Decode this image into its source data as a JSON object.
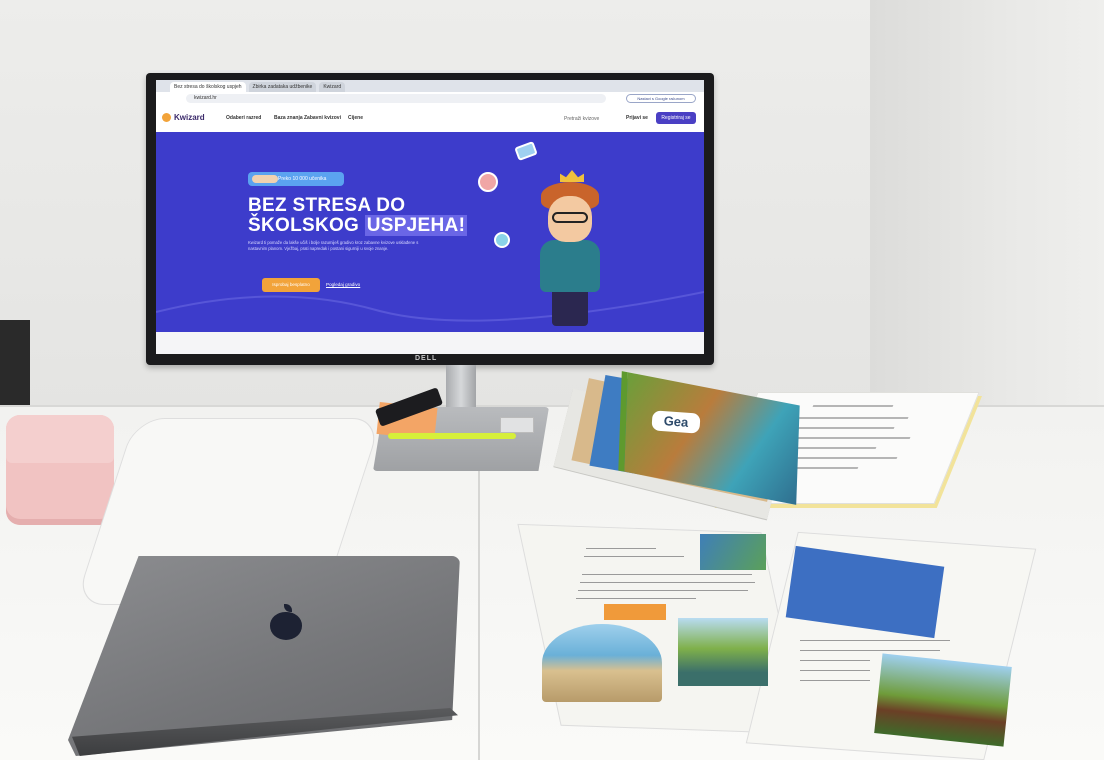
{
  "browser": {
    "tabs": [
      {
        "label": "Bez stresa do školskog uspjeh"
      },
      {
        "label": "Zbirka zadataka udžbenike"
      },
      {
        "label": "Kwizard"
      }
    ],
    "url": "kwizard.hr",
    "profile_button": "Nastavi s Google računom"
  },
  "site": {
    "logo": "Kwizard",
    "nav": [
      "Odaberi razred",
      "Baza znanja",
      "Zabavni kvizovi",
      "Cijene"
    ],
    "search_placeholder": "Pretraži kvizove",
    "login": "Prijavi se",
    "register": "Registriraj se",
    "hero": {
      "badge": "Preko 10 000 učenika",
      "title_line1": "BEZ STRESA DO",
      "title_line2a": "ŠKOLSKOG ",
      "title_line2b": "USPJEHA!",
      "text": "Kwizard ti pomaže da lakše učiš i bolje razumiješ gradivo kroz zabavne kvizove usklađene s nastavnim planom. Vježbaj, prati napredak i postani sigurniji u svoje znanje.",
      "cta": "Isprobaj besplatno",
      "secondary": "Pogledaj gradivo"
    }
  },
  "monitor_brand": "DELL",
  "book_title": "Gea"
}
